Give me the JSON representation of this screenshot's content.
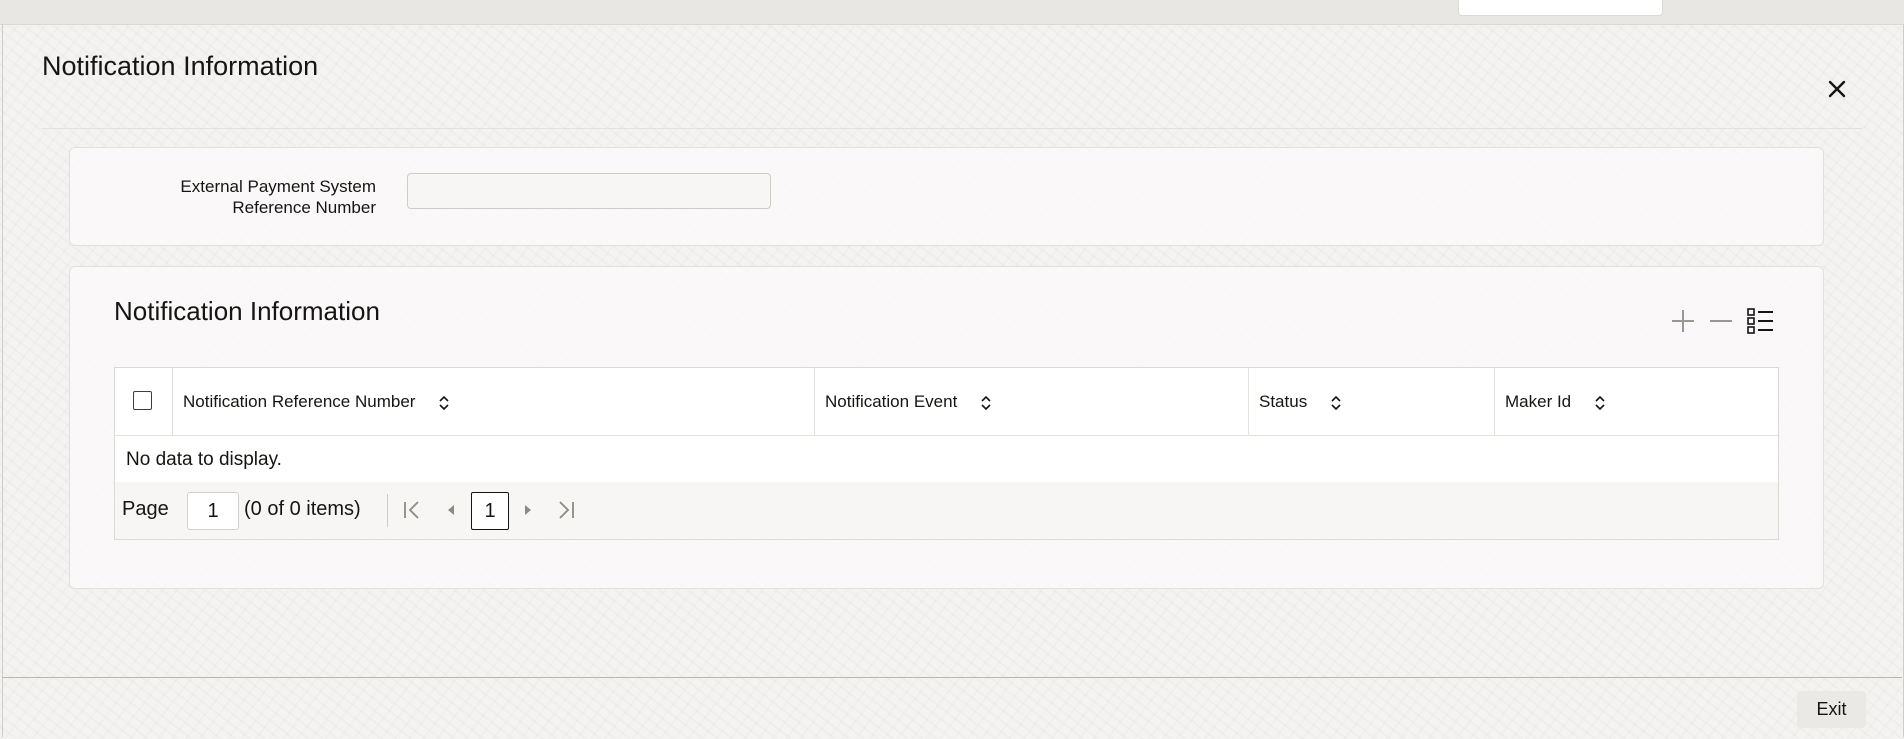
{
  "dialog": {
    "title": "Notification Information",
    "close_icon": "close-icon"
  },
  "form": {
    "ext_ref_label": "External Payment System Reference Number",
    "ext_ref_value": ""
  },
  "section": {
    "title": "Notification Information"
  },
  "toolbar": {
    "add_icon": "add-icon",
    "remove_icon": "remove-icon",
    "columns_icon": "column-list-icon"
  },
  "table": {
    "columns": [
      {
        "label": "Notification Reference Number"
      },
      {
        "label": "Notification Event"
      },
      {
        "label": "Status"
      },
      {
        "label": "Maker Id"
      }
    ],
    "empty_message": "No data to display."
  },
  "pagination": {
    "page_label": "Page",
    "page_value": "1",
    "count_text": "(0 of 0 items)",
    "current_page": "1"
  },
  "footer": {
    "exit_label": "Exit"
  },
  "colors": {
    "text": "#161513",
    "panel": "#faf9f8",
    "border": "#dcd9d4",
    "background": "#f4f3f1"
  }
}
